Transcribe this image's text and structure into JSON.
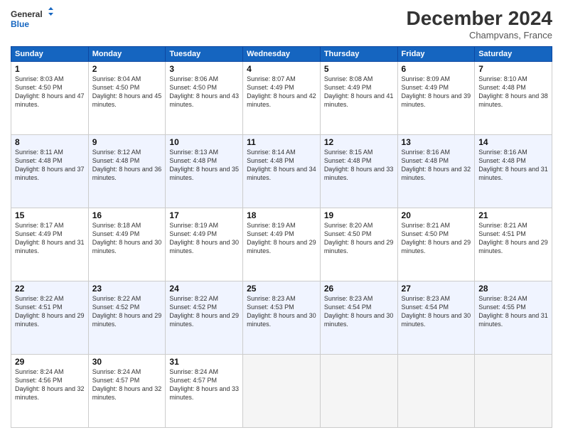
{
  "header": {
    "logo_line1": "General",
    "logo_line2": "Blue",
    "month": "December 2024",
    "location": "Champvans, France"
  },
  "days_of_week": [
    "Sunday",
    "Monday",
    "Tuesday",
    "Wednesday",
    "Thursday",
    "Friday",
    "Saturday"
  ],
  "weeks": [
    [
      {
        "day": "1",
        "sunrise": "Sunrise: 8:03 AM",
        "sunset": "Sunset: 4:50 PM",
        "daylight": "Daylight: 8 hours and 47 minutes."
      },
      {
        "day": "2",
        "sunrise": "Sunrise: 8:04 AM",
        "sunset": "Sunset: 4:50 PM",
        "daylight": "Daylight: 8 hours and 45 minutes."
      },
      {
        "day": "3",
        "sunrise": "Sunrise: 8:06 AM",
        "sunset": "Sunset: 4:50 PM",
        "daylight": "Daylight: 8 hours and 43 minutes."
      },
      {
        "day": "4",
        "sunrise": "Sunrise: 8:07 AM",
        "sunset": "Sunset: 4:49 PM",
        "daylight": "Daylight: 8 hours and 42 minutes."
      },
      {
        "day": "5",
        "sunrise": "Sunrise: 8:08 AM",
        "sunset": "Sunset: 4:49 PM",
        "daylight": "Daylight: 8 hours and 41 minutes."
      },
      {
        "day": "6",
        "sunrise": "Sunrise: 8:09 AM",
        "sunset": "Sunset: 4:49 PM",
        "daylight": "Daylight: 8 hours and 39 minutes."
      },
      {
        "day": "7",
        "sunrise": "Sunrise: 8:10 AM",
        "sunset": "Sunset: 4:48 PM",
        "daylight": "Daylight: 8 hours and 38 minutes."
      }
    ],
    [
      {
        "day": "8",
        "sunrise": "Sunrise: 8:11 AM",
        "sunset": "Sunset: 4:48 PM",
        "daylight": "Daylight: 8 hours and 37 minutes."
      },
      {
        "day": "9",
        "sunrise": "Sunrise: 8:12 AM",
        "sunset": "Sunset: 4:48 PM",
        "daylight": "Daylight: 8 hours and 36 minutes."
      },
      {
        "day": "10",
        "sunrise": "Sunrise: 8:13 AM",
        "sunset": "Sunset: 4:48 PM",
        "daylight": "Daylight: 8 hours and 35 minutes."
      },
      {
        "day": "11",
        "sunrise": "Sunrise: 8:14 AM",
        "sunset": "Sunset: 4:48 PM",
        "daylight": "Daylight: 8 hours and 34 minutes."
      },
      {
        "day": "12",
        "sunrise": "Sunrise: 8:15 AM",
        "sunset": "Sunset: 4:48 PM",
        "daylight": "Daylight: 8 hours and 33 minutes."
      },
      {
        "day": "13",
        "sunrise": "Sunrise: 8:16 AM",
        "sunset": "Sunset: 4:48 PM",
        "daylight": "Daylight: 8 hours and 32 minutes."
      },
      {
        "day": "14",
        "sunrise": "Sunrise: 8:16 AM",
        "sunset": "Sunset: 4:48 PM",
        "daylight": "Daylight: 8 hours and 31 minutes."
      }
    ],
    [
      {
        "day": "15",
        "sunrise": "Sunrise: 8:17 AM",
        "sunset": "Sunset: 4:49 PM",
        "daylight": "Daylight: 8 hours and 31 minutes."
      },
      {
        "day": "16",
        "sunrise": "Sunrise: 8:18 AM",
        "sunset": "Sunset: 4:49 PM",
        "daylight": "Daylight: 8 hours and 30 minutes."
      },
      {
        "day": "17",
        "sunrise": "Sunrise: 8:19 AM",
        "sunset": "Sunset: 4:49 PM",
        "daylight": "Daylight: 8 hours and 30 minutes."
      },
      {
        "day": "18",
        "sunrise": "Sunrise: 8:19 AM",
        "sunset": "Sunset: 4:49 PM",
        "daylight": "Daylight: 8 hours and 29 minutes."
      },
      {
        "day": "19",
        "sunrise": "Sunrise: 8:20 AM",
        "sunset": "Sunset: 4:50 PM",
        "daylight": "Daylight: 8 hours and 29 minutes."
      },
      {
        "day": "20",
        "sunrise": "Sunrise: 8:21 AM",
        "sunset": "Sunset: 4:50 PM",
        "daylight": "Daylight: 8 hours and 29 minutes."
      },
      {
        "day": "21",
        "sunrise": "Sunrise: 8:21 AM",
        "sunset": "Sunset: 4:51 PM",
        "daylight": "Daylight: 8 hours and 29 minutes."
      }
    ],
    [
      {
        "day": "22",
        "sunrise": "Sunrise: 8:22 AM",
        "sunset": "Sunset: 4:51 PM",
        "daylight": "Daylight: 8 hours and 29 minutes."
      },
      {
        "day": "23",
        "sunrise": "Sunrise: 8:22 AM",
        "sunset": "Sunset: 4:52 PM",
        "daylight": "Daylight: 8 hours and 29 minutes."
      },
      {
        "day": "24",
        "sunrise": "Sunrise: 8:22 AM",
        "sunset": "Sunset: 4:52 PM",
        "daylight": "Daylight: 8 hours and 29 minutes."
      },
      {
        "day": "25",
        "sunrise": "Sunrise: 8:23 AM",
        "sunset": "Sunset: 4:53 PM",
        "daylight": "Daylight: 8 hours and 30 minutes."
      },
      {
        "day": "26",
        "sunrise": "Sunrise: 8:23 AM",
        "sunset": "Sunset: 4:54 PM",
        "daylight": "Daylight: 8 hours and 30 minutes."
      },
      {
        "day": "27",
        "sunrise": "Sunrise: 8:23 AM",
        "sunset": "Sunset: 4:54 PM",
        "daylight": "Daylight: 8 hours and 30 minutes."
      },
      {
        "day": "28",
        "sunrise": "Sunrise: 8:24 AM",
        "sunset": "Sunset: 4:55 PM",
        "daylight": "Daylight: 8 hours and 31 minutes."
      }
    ],
    [
      {
        "day": "29",
        "sunrise": "Sunrise: 8:24 AM",
        "sunset": "Sunset: 4:56 PM",
        "daylight": "Daylight: 8 hours and 32 minutes."
      },
      {
        "day": "30",
        "sunrise": "Sunrise: 8:24 AM",
        "sunset": "Sunset: 4:57 PM",
        "daylight": "Daylight: 8 hours and 32 minutes."
      },
      {
        "day": "31",
        "sunrise": "Sunrise: 8:24 AM",
        "sunset": "Sunset: 4:57 PM",
        "daylight": "Daylight: 8 hours and 33 minutes."
      },
      null,
      null,
      null,
      null
    ]
  ]
}
